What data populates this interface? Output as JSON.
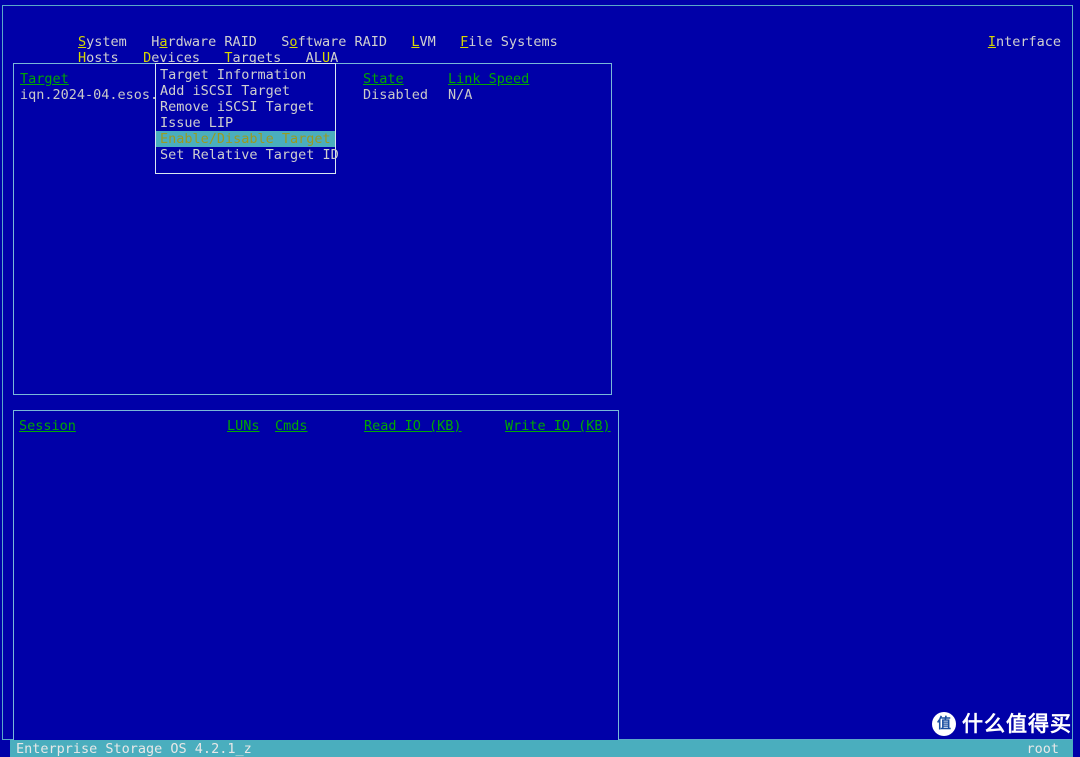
{
  "app": {
    "title": "Enterprise Storage OS 4.2.1_z",
    "user": "root"
  },
  "colors": {
    "background": "#0000a8",
    "panel_border": "#79b8d8",
    "window_border": "#5aa8c8",
    "column_header": "#00a800",
    "hotkey": "#d8d800",
    "text": "#c9c9c9",
    "highlight_bg": "#4aaebe",
    "highlight_fg": "#9a9a22",
    "statusbar_bg": "#4aaebe"
  },
  "menubar": {
    "row1": [
      {
        "label": "System",
        "hotkey": "S",
        "pre": "",
        "post": "ystem"
      },
      {
        "label": "Hardware RAID",
        "hotkey": "a",
        "pre": "H",
        "post": "rdware RAID"
      },
      {
        "label": "Software RAID",
        "hotkey": "o",
        "pre": "S",
        "post": "ftware RAID"
      },
      {
        "label": "LVM",
        "hotkey": "L",
        "pre": "",
        "post": "VM"
      },
      {
        "label": "File Systems",
        "hotkey": "F",
        "pre": "",
        "post": "ile Systems"
      }
    ],
    "row2": [
      {
        "label": "Hosts",
        "hotkey": "H",
        "pre": "",
        "post": "osts"
      },
      {
        "label": "Devices",
        "hotkey": "D",
        "pre": "",
        "post": "evices"
      },
      {
        "label": "Targets",
        "hotkey": "T",
        "pre": "",
        "post": "argets"
      },
      {
        "label": "ALUA",
        "hotkey": "U",
        "pre": "AL",
        "post": "A"
      }
    ],
    "interface": {
      "label": "Interface",
      "hotkey": "I",
      "pre": "",
      "post": "nterface"
    }
  },
  "dropdown": {
    "owner": "Targets",
    "selected_index": 4,
    "items": [
      "Target Information",
      "Add iSCSI Target",
      "Remove iSCSI Target",
      "Issue LIP",
      "Enable/Disable Target",
      "Set Relative Target ID"
    ]
  },
  "targets_panel": {
    "columns": [
      "Target",
      "State",
      "Link Speed"
    ],
    "rows": [
      {
        "target": "iqn.2024-04.esos.",
        "state": "Disabled",
        "link_speed": "N/A"
      }
    ]
  },
  "sessions_panel": {
    "columns": [
      "Session",
      "LUNs",
      "Cmds",
      "Read IO (KB)",
      "Write IO (KB)"
    ],
    "rows": []
  },
  "watermark": {
    "badge": "值",
    "text": "什么值得买"
  }
}
